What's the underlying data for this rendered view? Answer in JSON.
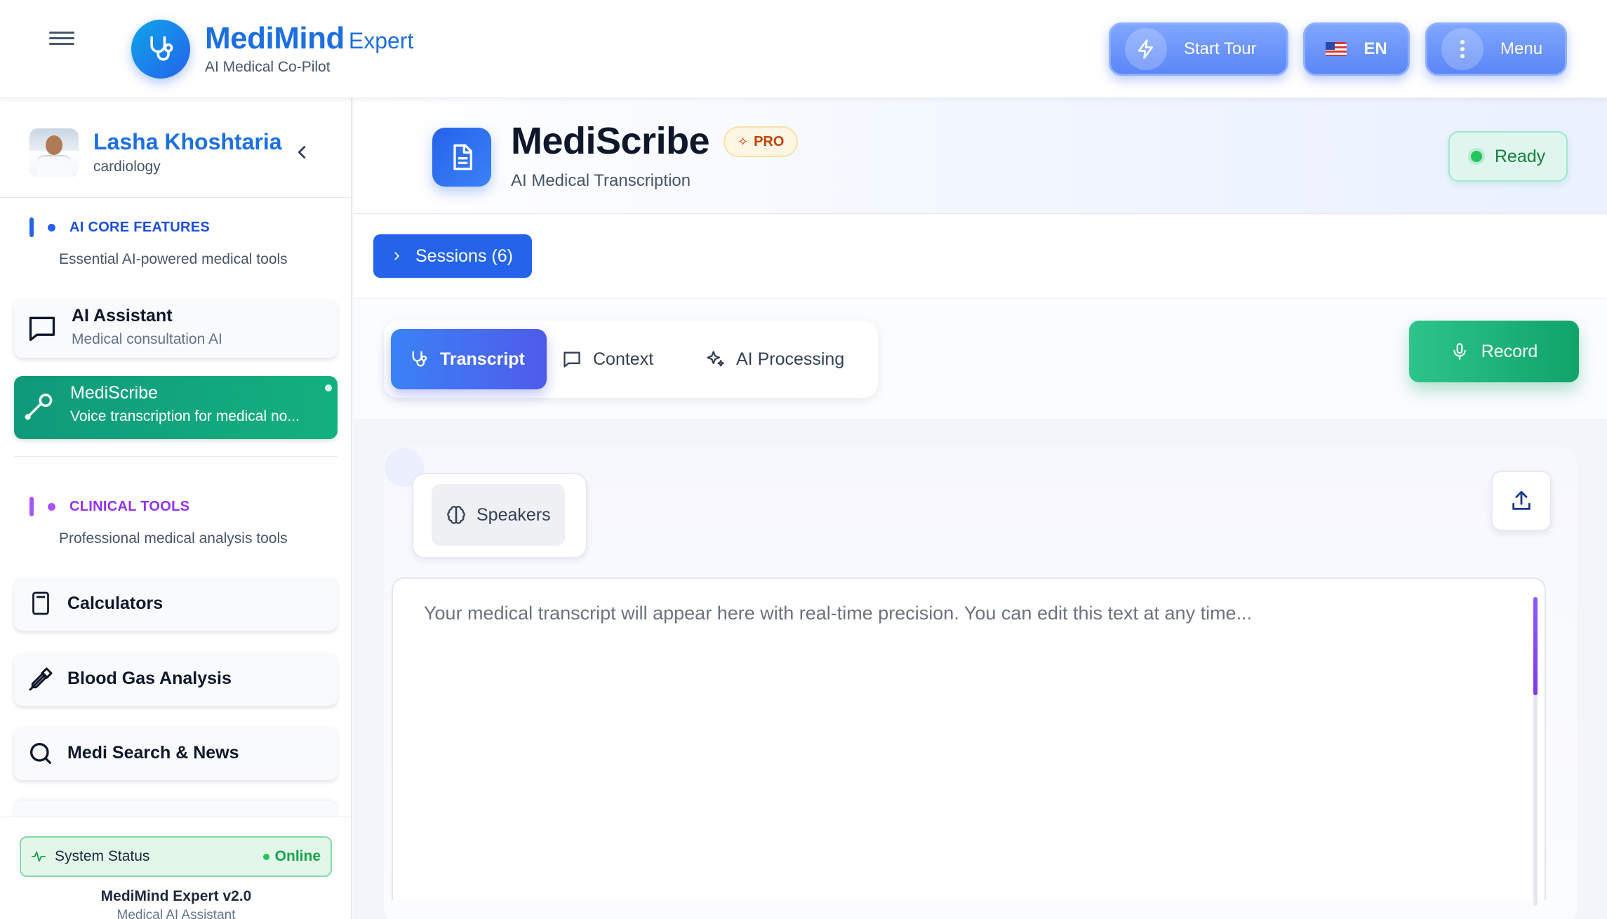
{
  "header": {
    "brand_name": "MediMind",
    "brand_suffix": "Expert",
    "tagline": "AI Medical Co-Pilot",
    "start_tour_label": "Start Tour",
    "language_label": "EN",
    "menu_label": "Menu"
  },
  "sidebar": {
    "user": {
      "name": "Lasha Khoshtaria",
      "specialty": "cardiology"
    },
    "sections": [
      {
        "title": "AI CORE FEATURES",
        "description": "Essential AI-powered medical tools",
        "color": "#2563eb",
        "items": [
          {
            "label": "AI Assistant",
            "description": "Medical consultation AI",
            "icon": "chat-bubble-icon"
          },
          {
            "label": "MediScribe",
            "description": "Voice transcription for medical no...",
            "icon": "stethoscope-icon",
            "active": true
          }
        ]
      },
      {
        "title": "CLINICAL TOOLS",
        "description": "Professional medical analysis tools",
        "color": "#9333ea",
        "items": [
          {
            "label": "Calculators",
            "icon": "calculator-icon"
          },
          {
            "label": "Blood Gas Analysis",
            "icon": "pipette-icon"
          },
          {
            "label": "Medi Search & News",
            "icon": "search-icon"
          }
        ]
      }
    ],
    "system_status": {
      "label": "System Status",
      "value": "Online"
    },
    "version": "MediMind Expert v2.0",
    "version_sub": "Medical AI Assistant"
  },
  "page": {
    "title": "MediScribe",
    "badge": "PRO",
    "subtitle": "AI Medical Transcription",
    "status": "Ready",
    "sessions_label": "Sessions (6)",
    "tabs": [
      {
        "label": "Transcript",
        "icon": "stethoscope-icon",
        "active": true
      },
      {
        "label": "Context",
        "icon": "chat-bubble-icon"
      },
      {
        "label": "AI Processing",
        "icon": "sparkles-icon"
      }
    ],
    "record_label": "Record",
    "speakers_label": "Speakers",
    "transcript_placeholder": "Your medical transcript will appear here with real-time precision. You can edit this text at any time..."
  },
  "colors": {
    "brand_blue": "#1d6fe0",
    "active_green": "#13b07f",
    "record_green": "#10a36a",
    "ready_green": "#15803d"
  }
}
